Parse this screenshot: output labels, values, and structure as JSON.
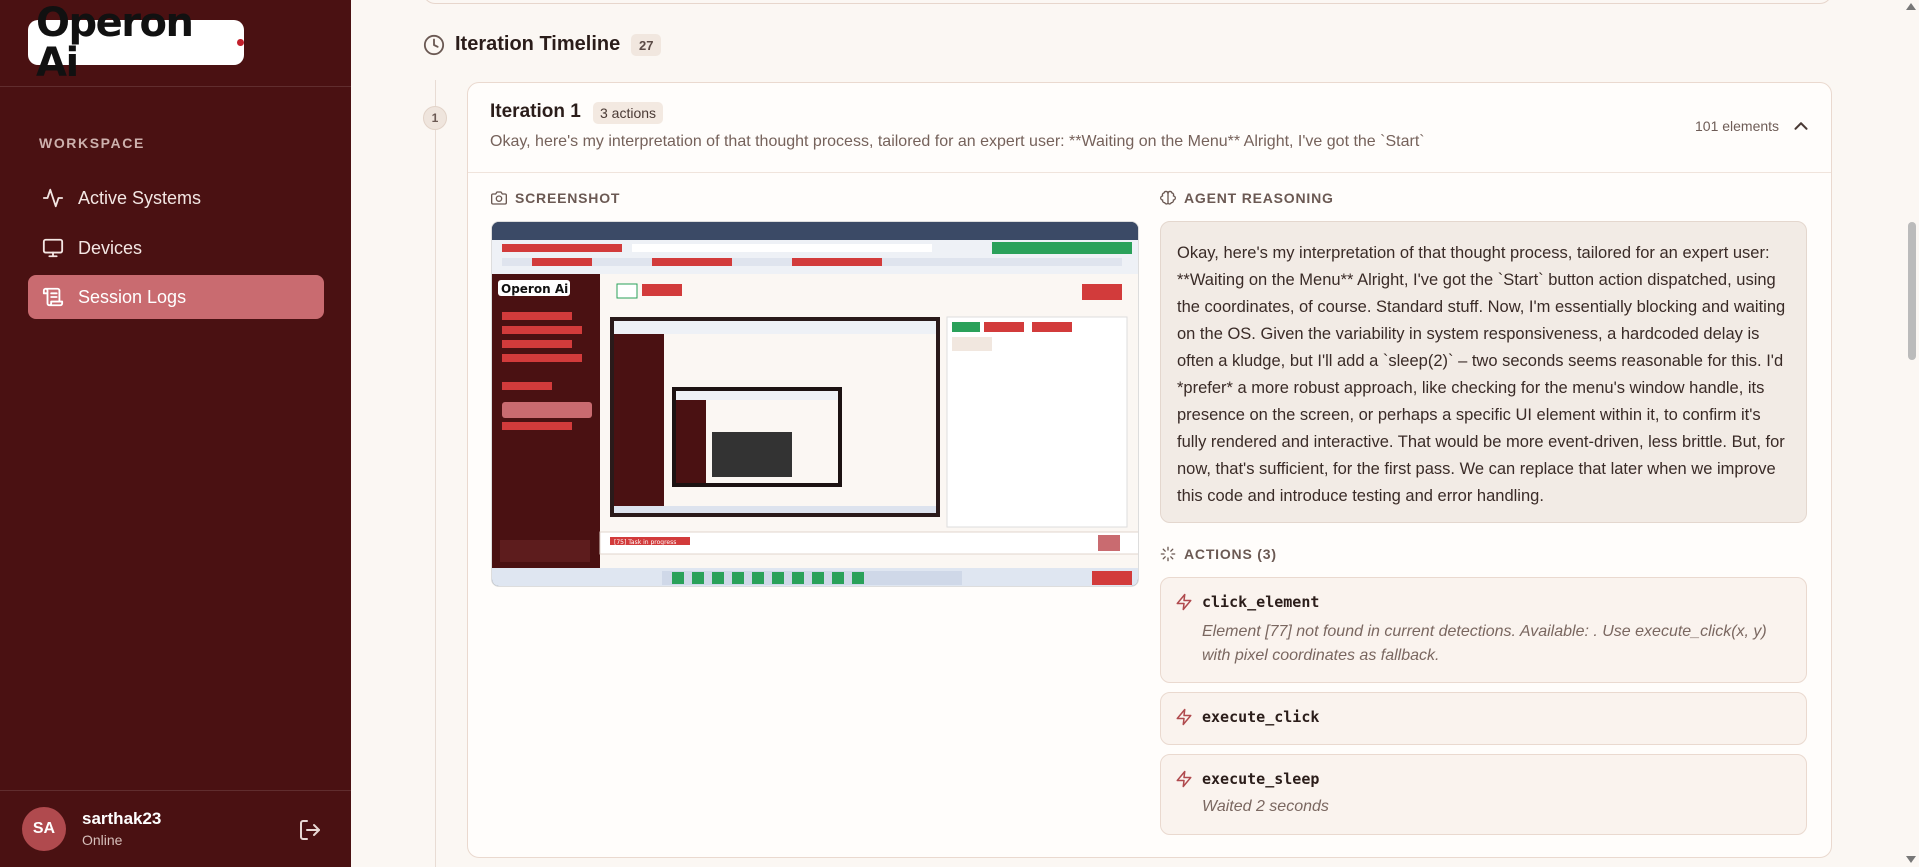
{
  "app": {
    "logo_text": "Operon Ai",
    "brand_accent": "#c21f2b",
    "sidebar_bg": "#4a1112",
    "active_item_bg": "#c96b70"
  },
  "sidebar": {
    "section_label": "WORKSPACE",
    "items": [
      {
        "label": "Active Systems",
        "icon": "activity-icon",
        "active": false
      },
      {
        "label": "Devices",
        "icon": "monitor-icon",
        "active": false
      },
      {
        "label": "Session Logs",
        "icon": "scroll-icon",
        "active": true
      }
    ],
    "user": {
      "initials": "SA",
      "name": "sarthak23",
      "status": "Online"
    }
  },
  "timeline": {
    "title": "Iteration Timeline",
    "count": "27"
  },
  "iteration": {
    "number": "1",
    "title": "Iteration 1",
    "actions_badge": "3 actions",
    "summary": "Okay, here's my interpretation of that thought process, tailored for an expert user: **Waiting on the Menu** Alright, I've got the `Start`",
    "elements_count": "101 elements",
    "screenshot_label": "SCREENSHOT",
    "reasoning_label": "AGENT REASONING",
    "reasoning_text": "Okay, here's my interpretation of that thought process, tailored for an expert user: **Waiting on the Menu** Alright, I've got the `Start` button action dispatched, using the coordinates, of course. Standard stuff. Now, I'm essentially blocking and waiting on the OS. Given the variability in system responsiveness, a hardcoded delay is often a kludge, but I'll add a `sleep(2)` – two seconds seems reasonable for this. I'd *prefer* a more robust approach, like checking for the menu's window handle, its presence on the screen, or perhaps a specific UI element within it, to confirm it's fully rendered and interactive. That would be more event-driven, less brittle. But, for now, that's sufficient, for the first pass. We can replace that later when we improve this code and introduce testing and error handling.",
    "actions_label": "ACTIONS (3)",
    "actions": [
      {
        "name": "click_element",
        "detail": "Element [77] not found in current detections. Available: . Use execute_click(x, y) with pixel coordinates as fallback."
      },
      {
        "name": "execute_click",
        "detail": ""
      },
      {
        "name": "execute_sleep",
        "detail": "Waited 2 seconds"
      }
    ]
  },
  "screenshot_thumb": {
    "logo_text": "Operon Ai",
    "footer_label": "[75] Task in progress"
  }
}
